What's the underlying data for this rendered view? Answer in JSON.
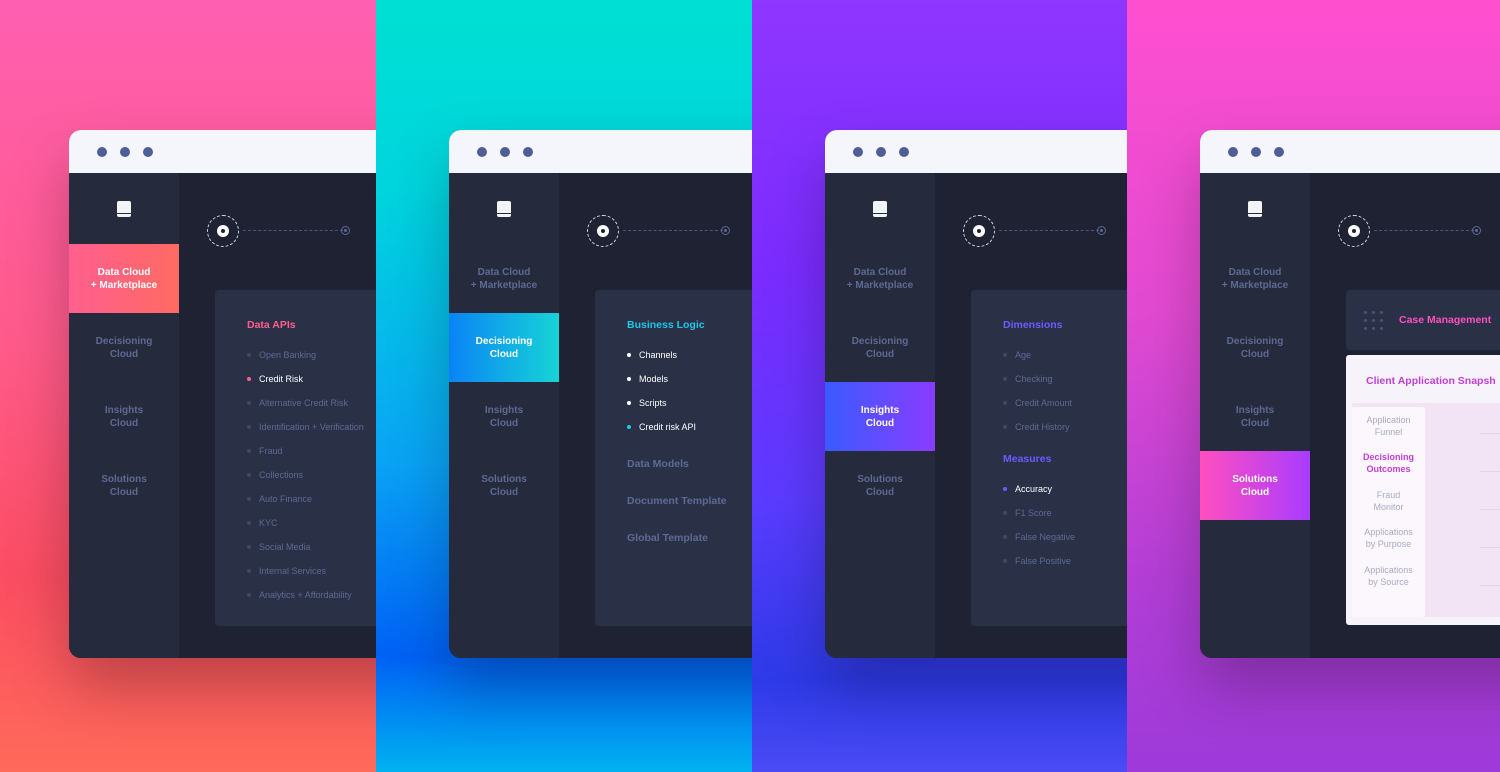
{
  "window": {
    "dots": 3
  },
  "nav": {
    "data_cloud": "Data Cloud\n+ Marketplace",
    "decisioning": "Decisioning\nCloud",
    "insights": "Insights\nCloud",
    "solutions": "Solutions\nCloud"
  },
  "panel1": {
    "card_title": "Data APIs",
    "items": [
      "Open Banking",
      "Credit Risk",
      "Alternative Credit Risk",
      "Identification + Verification",
      "Fraud",
      "Collections",
      "Auto Finance",
      "KYC",
      "Social Media",
      "Internal Services",
      "Analytics + Affordability"
    ]
  },
  "panel2": {
    "card_title": "Business Logic",
    "items": [
      "Channels",
      "Models",
      "Scripts",
      "Credit risk API"
    ],
    "sections": [
      "Data Models",
      "Document Template",
      "Global Template"
    ]
  },
  "panel3": {
    "dimensions_title": "Dimensions",
    "dimensions": [
      "Age",
      "Checking",
      "Credit Amount",
      "Credit History"
    ],
    "measures_title": "Measures",
    "measures": [
      "Accuracy",
      "F1 Score",
      "False Negative",
      "False Positive"
    ]
  },
  "panel4": {
    "case_label": "Case Management",
    "snapshot_title": "Client Application Snapsh",
    "snapshot_items": [
      "Application\nFunnel",
      "Decisioning\nOutcomes",
      "Fraud\nMonitor",
      "Applications\nby Purpose",
      "Applications\nby Source"
    ]
  },
  "colors": {
    "panel1_accent": "#ff5f8f",
    "panel2_accent": "#1dc8e8",
    "panel3_accent": "#6d5bff",
    "panel4_accent": "#c23fd6"
  }
}
